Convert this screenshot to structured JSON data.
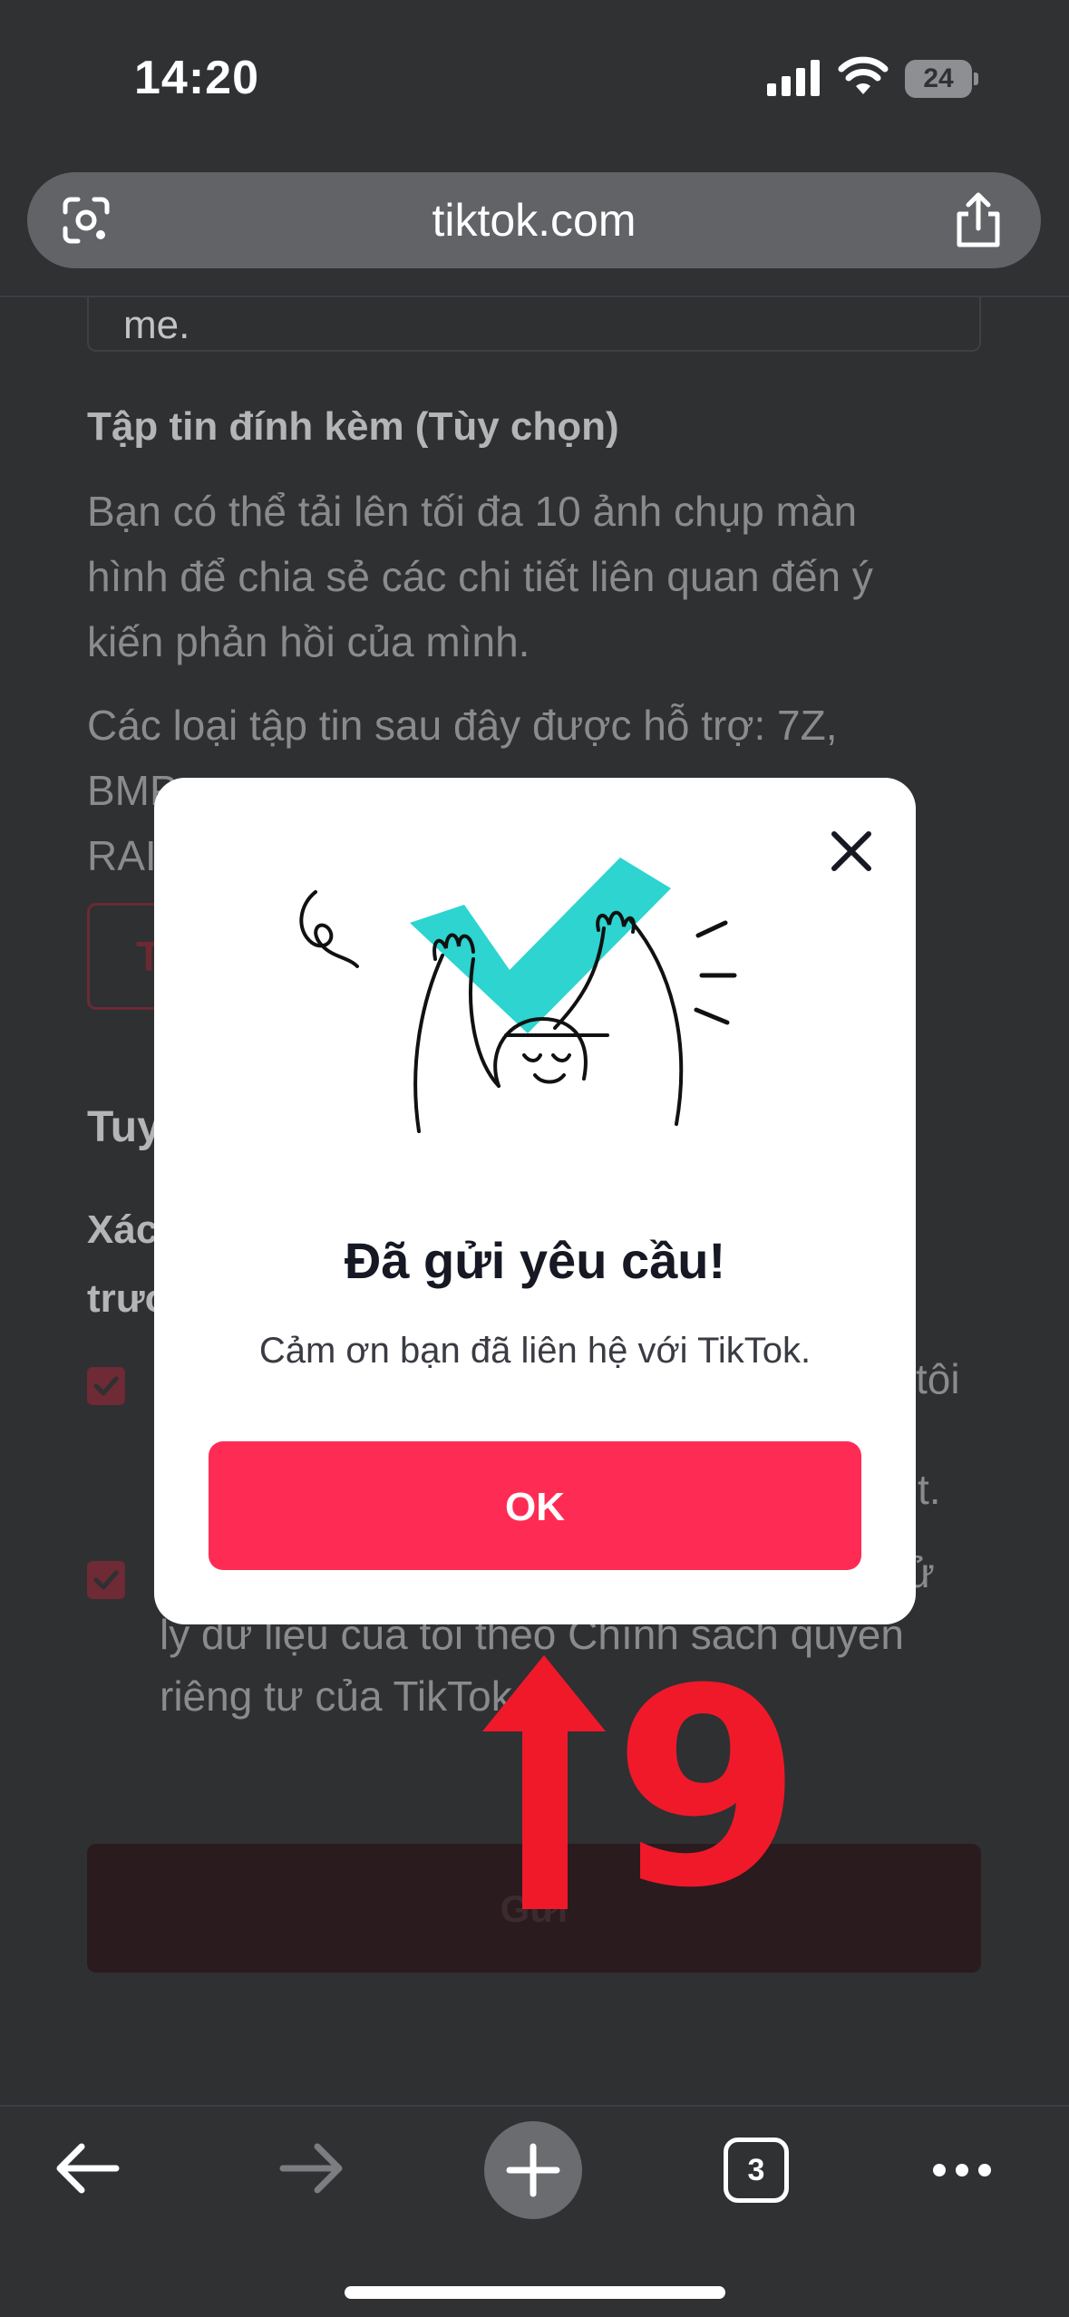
{
  "status_bar": {
    "time": "14:20",
    "battery_level": "24",
    "icons": [
      "cellular-signal-icon",
      "wifi-icon",
      "battery-icon"
    ]
  },
  "browser": {
    "url": "tiktok.com",
    "icons": [
      "google-lens-icon",
      "share-icon"
    ]
  },
  "page": {
    "textarea_tail": "me.",
    "attachments_title": "Tập tin đính kèm (Tùy chọn)",
    "attachments_desc_lines": [
      "Bạn có thể tải lên tối đa 10 ảnh chụp màn",
      "hình để chia sẻ các chi tiết liên quan đến ý",
      "kiến phản hồi của mình."
    ],
    "attachments_types_lines": [
      "Các loại tập tin sau đây được hỗ trợ: 7Z,",
      "BMP",
      "RAI"
    ],
    "upload_button_label": "T",
    "section_title": "Tuy",
    "confirm_lines": [
      "Xác",
      "trươ"
    ],
    "checkbox1_tails": [
      "tôi",
      "t."
    ],
    "checkbox2_lines": [
      "ử",
      "ly dữ liệu của tôi theo Chính sách quyền",
      "riêng tư của TikTok"
    ],
    "submit_label": "Gửi"
  },
  "dialog": {
    "title": "Đã gửi yêu cầu!",
    "message": "Cảm ơn bạn đã liên hệ với TikTok.",
    "ok_label": "OK"
  },
  "annotation": {
    "step_number": "9",
    "color": "#f0192a"
  },
  "toolbar": {
    "tabs_count": "3",
    "icons": [
      "back-arrow-icon",
      "forward-arrow-icon",
      "new-tab-plus-icon",
      "tabs-icon",
      "more-options-icon"
    ]
  },
  "colors": {
    "accent": "#fe2c55",
    "check_teal": "#2dd4d0",
    "background": "#2f3133"
  }
}
